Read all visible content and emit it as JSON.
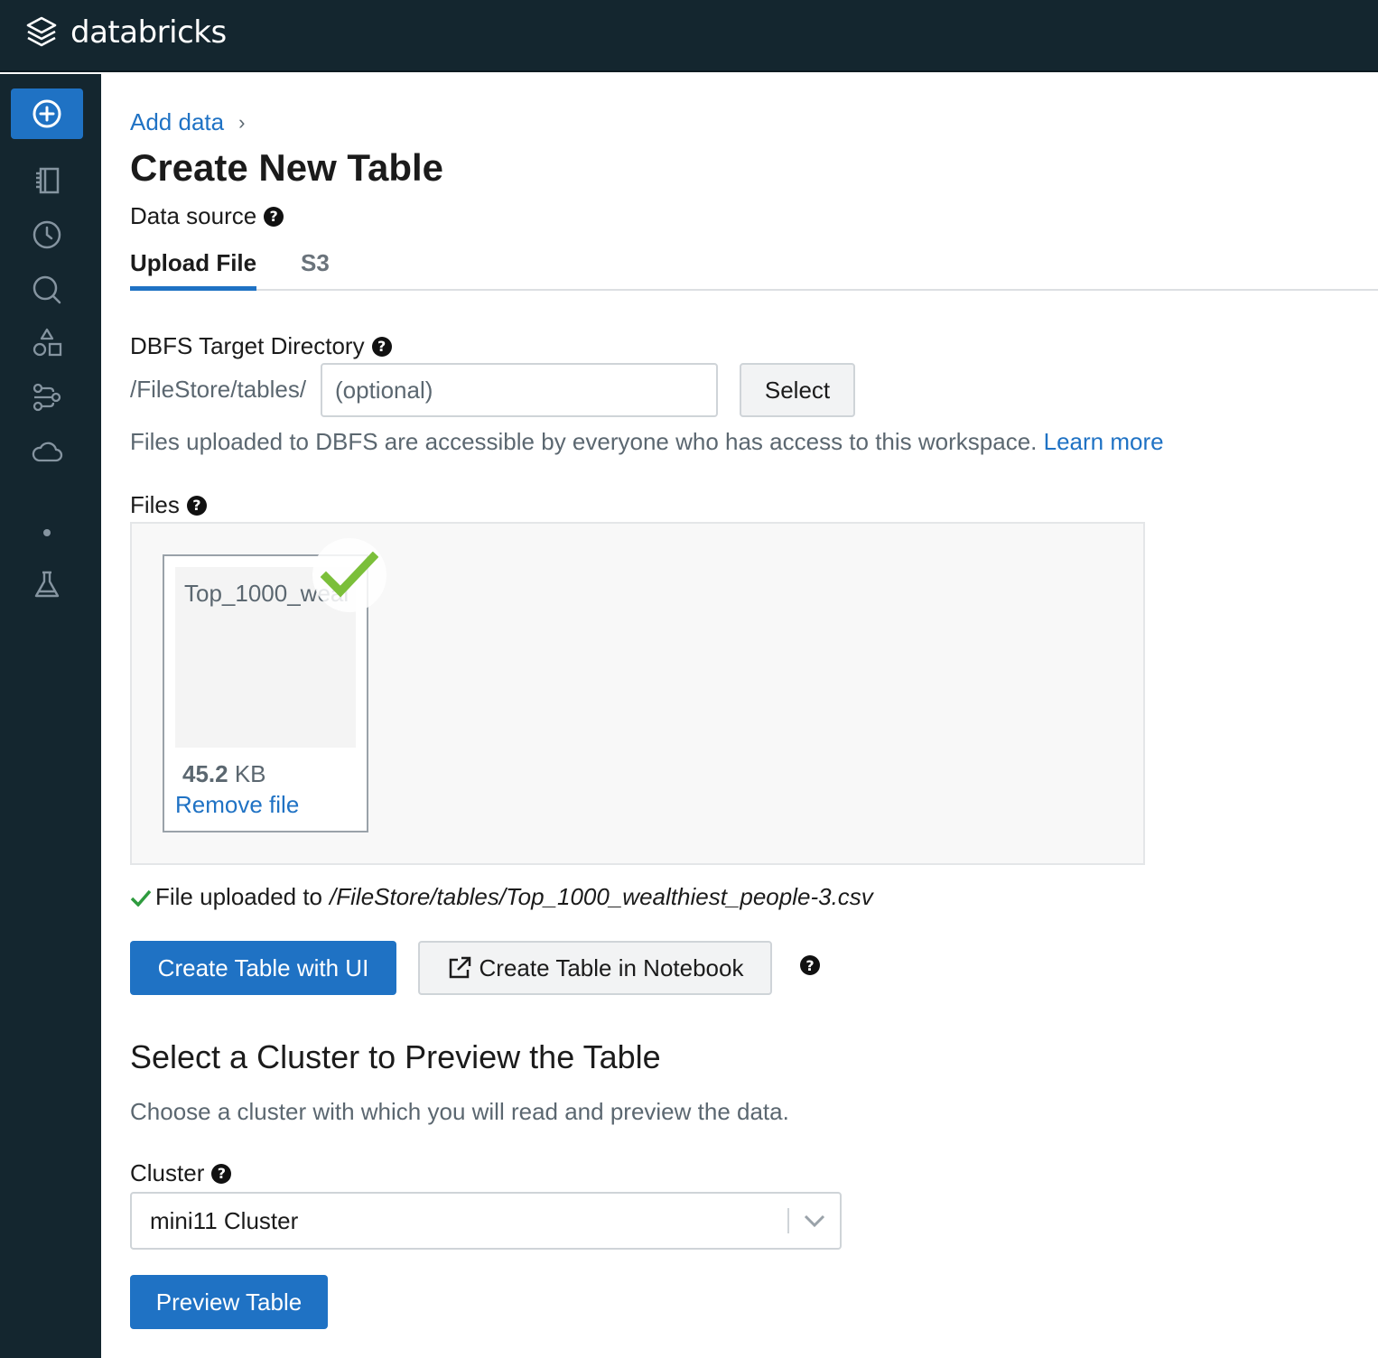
{
  "app": {
    "brand": "databricks"
  },
  "sidebar": {
    "items": [
      {
        "icon": "plus-circle-icon"
      },
      {
        "icon": "notebook-icon"
      },
      {
        "icon": "clock-icon"
      },
      {
        "icon": "search-icon"
      },
      {
        "icon": "shapes-icon"
      },
      {
        "icon": "workflow-icon"
      },
      {
        "icon": "cloud-icon"
      },
      {
        "icon": "flask-icon"
      }
    ]
  },
  "breadcrumb": {
    "label": "Add data",
    "separator": "›"
  },
  "page": {
    "title": "Create New Table",
    "data_source_label": "Data source",
    "tabs": [
      {
        "label": "Upload File",
        "active": true
      },
      {
        "label": "S3",
        "active": false
      }
    ]
  },
  "dbfs": {
    "label": "DBFS Target Directory",
    "prefix": "/FileStore/tables/",
    "placeholder": "(optional)",
    "select_label": "Select",
    "note": "Files uploaded to DBFS are accessible by everyone who has access to this workspace.",
    "learn_more": "Learn more"
  },
  "files": {
    "label": "Files",
    "items": [
      {
        "name": "Top_1000_weal",
        "size_value": "45.2",
        "size_unit": "KB",
        "remove_label": "Remove file"
      }
    ]
  },
  "upload_status": {
    "prefix": "File uploaded to",
    "path": "/FileStore/tables/Top_1000_wealthiest_people-3.csv"
  },
  "actions": {
    "create_ui": "Create Table with UI",
    "create_notebook": "Create Table in Notebook"
  },
  "cluster_section": {
    "heading": "Select a Cluster to Preview the Table",
    "description": "Choose a cluster with which you will read and preview the data.",
    "cluster_label": "Cluster",
    "selected_cluster": "mini11 Cluster",
    "preview_button": "Preview Table"
  },
  "colors": {
    "primary": "#1f72c4",
    "topbar": "#14262f",
    "success": "#2e9b3e",
    "check_badge": "#7bbf3a"
  }
}
